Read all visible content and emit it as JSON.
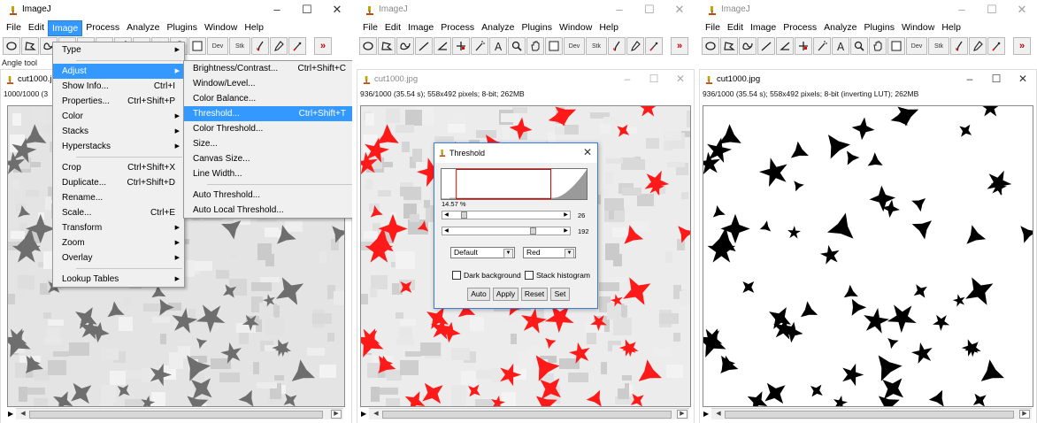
{
  "left": {
    "app_title": "ImageJ",
    "menu": [
      "File",
      "Edit",
      "Image",
      "Process",
      "Analyze",
      "Plugins",
      "Window",
      "Help"
    ],
    "open_menu_index": 2,
    "status": "Angle tool",
    "image_window": {
      "title": "cut1000.j",
      "info": "1000/1000 (3"
    },
    "image_menu": [
      {
        "label": "Type",
        "shortcut": "",
        "submenu": true
      },
      {
        "sep": true
      },
      {
        "label": "Adjust",
        "shortcut": "",
        "submenu": true,
        "highlight": true
      },
      {
        "label": "Show Info...",
        "shortcut": "Ctrl+I"
      },
      {
        "label": "Properties...",
        "shortcut": "Ctrl+Shift+P"
      },
      {
        "label": "Color",
        "shortcut": "",
        "submenu": true
      },
      {
        "label": "Stacks",
        "shortcut": "",
        "submenu": true
      },
      {
        "label": "Hyperstacks",
        "shortcut": "",
        "submenu": true
      },
      {
        "sep": true
      },
      {
        "label": "Crop",
        "shortcut": "Ctrl+Shift+X"
      },
      {
        "label": "Duplicate...",
        "shortcut": "Ctrl+Shift+D"
      },
      {
        "label": "Rename...",
        "shortcut": ""
      },
      {
        "label": "Scale...",
        "shortcut": "Ctrl+E"
      },
      {
        "label": "Transform",
        "shortcut": "",
        "submenu": true
      },
      {
        "label": "Zoom",
        "shortcut": "",
        "submenu": true
      },
      {
        "label": "Overlay",
        "shortcut": "",
        "submenu": true
      },
      {
        "sep": true
      },
      {
        "label": "Lookup Tables",
        "shortcut": "",
        "submenu": true
      }
    ],
    "adjust_menu": [
      {
        "label": "Brightness/Contrast...",
        "shortcut": "Ctrl+Shift+C"
      },
      {
        "label": "Window/Level...",
        "shortcut": ""
      },
      {
        "label": "Color Balance...",
        "shortcut": ""
      },
      {
        "label": "Threshold...",
        "shortcut": "Ctrl+Shift+T",
        "highlight": true
      },
      {
        "label": "Color Threshold...",
        "shortcut": ""
      },
      {
        "label": "Size...",
        "shortcut": ""
      },
      {
        "label": "Canvas Size...",
        "shortcut": ""
      },
      {
        "label": "Line Width...",
        "shortcut": ""
      },
      {
        "sep": true
      },
      {
        "label": "Auto Threshold...",
        "shortcut": ""
      },
      {
        "label": "Auto Local Threshold...",
        "shortcut": ""
      }
    ]
  },
  "middle": {
    "app_title": "ImageJ",
    "menu": [
      "File",
      "Edit",
      "Image",
      "Process",
      "Analyze",
      "Plugins",
      "Window",
      "Help"
    ],
    "image_window": {
      "title": "cut1000.jpg",
      "info": "936/1000 (35.54 s); 558x492 pixels; 8-bit; 262MB"
    },
    "threshold_dialog": {
      "title": "Threshold",
      "percent": "14.57 %",
      "lower_value": "26",
      "upper_value": "192",
      "lower_fraction": 0.102,
      "upper_fraction": 0.753,
      "method": "Default",
      "display": "Red",
      "dark_background_label": "Dark background",
      "stack_histogram_label": "Stack histogram",
      "buttons": [
        "Auto",
        "Apply",
        "Reset",
        "Set"
      ]
    }
  },
  "right": {
    "app_title": "ImageJ",
    "menu": [
      "File",
      "Edit",
      "Image",
      "Process",
      "Analyze",
      "Plugins",
      "Window",
      "Help"
    ],
    "image_window": {
      "title": "cut1000.jpg",
      "info": "936/1000 (35.54 s); 558x492 pixels; 8-bit (inverting LUT); 262MB"
    }
  },
  "toolbar": {
    "tools": [
      "rectangle-tool",
      "oval-tool",
      "polygon-tool",
      "freehand-tool",
      "line-tool",
      "angle-tool",
      "point-tool",
      "wand-tool",
      "text-tool",
      "magnifier-tool",
      "hand-tool",
      "color-picker-tool",
      "dev-menu",
      "stk-menu",
      "brush-tool",
      "dropper-tool",
      "pencil-tool"
    ],
    "dev_label": "Dev",
    "stk_label": "Stk",
    "more_label": "»",
    "text_label": "A"
  },
  "window_controls": {
    "minimize": "–",
    "maximize": "☐",
    "close": "✕"
  },
  "colors": {
    "highlight": "#3399ff",
    "threshold_red": "#ff0000",
    "bg_gray": "#d0d0d0"
  }
}
